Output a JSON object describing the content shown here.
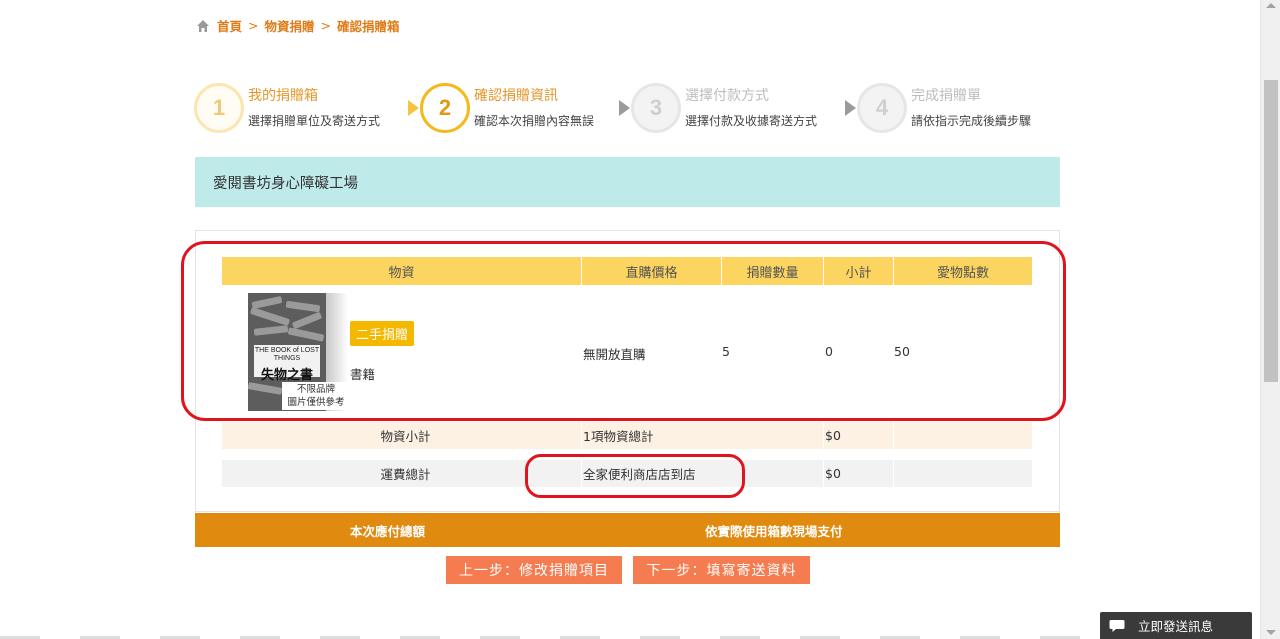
{
  "breadcrumb": {
    "items": [
      "首頁",
      "物資捐贈",
      "確認捐贈箱"
    ],
    "separator": ">"
  },
  "steps": [
    {
      "number": "1",
      "title": "我的捐贈箱",
      "desc": "選擇捐贈單位及寄送方式"
    },
    {
      "number": "2",
      "title": "確認捐贈資訊",
      "desc": "確認本次捐贈內容無誤"
    },
    {
      "number": "3",
      "title": "選擇付款方式",
      "desc": "選擇付款及收據寄送方式"
    },
    {
      "number": "4",
      "title": "完成捐贈單",
      "desc": "請依指示完成後續步驟"
    }
  ],
  "organization": "愛閱書坊身心障礙工場",
  "table": {
    "headers": [
      "物資",
      "直購價格",
      "捐贈數量",
      "小計",
      "愛物點數"
    ],
    "item": {
      "cover_title_en": "THE BOOK of LOST THINGS",
      "cover_title_zh": "失物之書",
      "disclaimer_line1": "不限品牌",
      "disclaimer_line2": "圖片僅供參考",
      "badge": "二手捐贈",
      "category": "書籍",
      "price": "無開放直購",
      "quantity": "5",
      "subtotal": "0",
      "points": "50"
    },
    "summary": [
      {
        "label": "物資小計",
        "desc": "1項物資總計",
        "amount": "$0"
      },
      {
        "label": "運費總計",
        "desc": "全家便利商店店到店",
        "amount": "$0"
      }
    ]
  },
  "total": {
    "label": "本次應付總額",
    "value": "依實際使用箱數現場支付"
  },
  "buttons": {
    "prev": "上一步：修改捐贈項目",
    "next": "下一步：填寫寄送資料"
  },
  "chat": {
    "label": "立即發送訊息"
  },
  "colors": {
    "accent_orange": "#e08a10",
    "header_yellow": "#fcd460",
    "org_bar": "#bfeaea",
    "button": "#f47c50",
    "annotation_red": "#e1141d"
  }
}
